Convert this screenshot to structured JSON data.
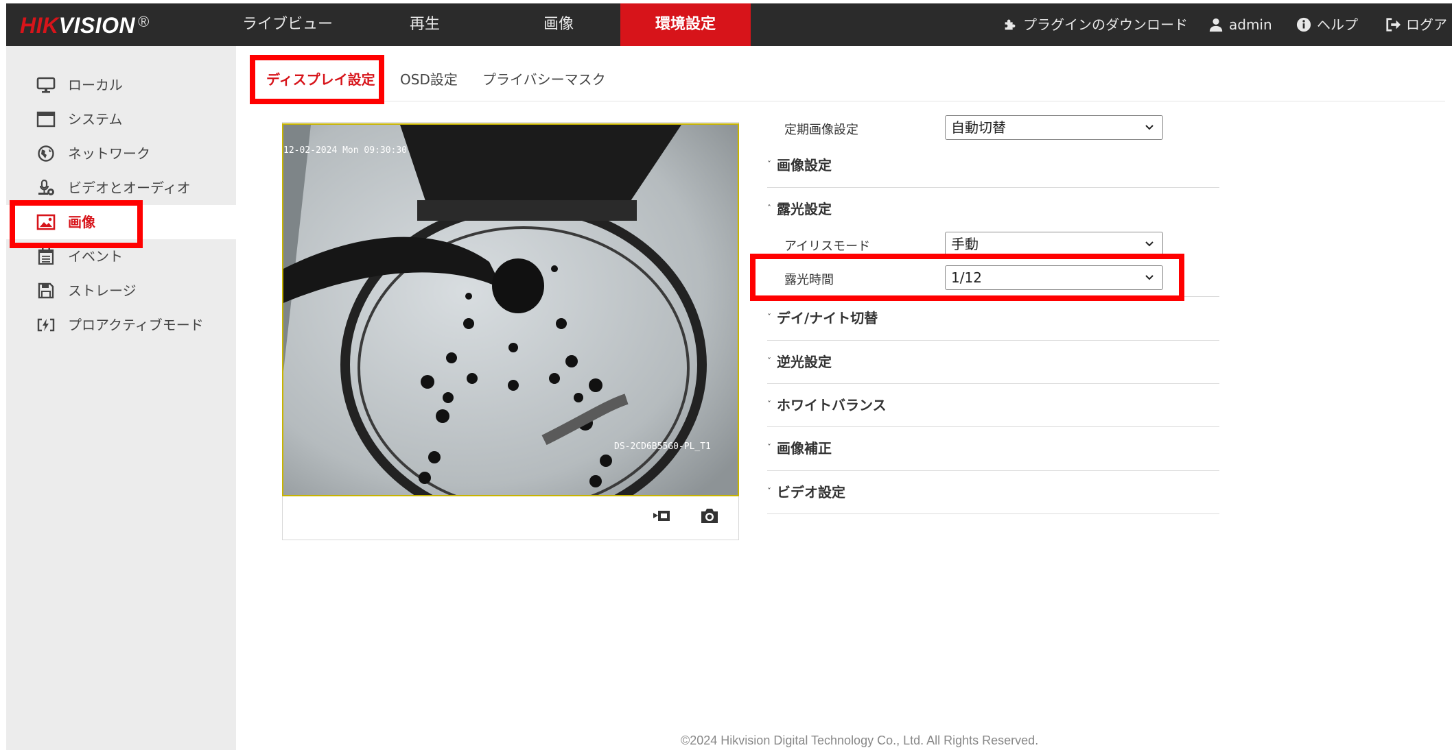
{
  "header": {
    "logo_red": "HIK",
    "logo_white": "VISION",
    "logo_mark": "®",
    "nav": [
      {
        "label": "ライブビュー"
      },
      {
        "label": "再生"
      },
      {
        "label": "画像"
      },
      {
        "label": "環境設定",
        "active": true
      }
    ],
    "plugin_label": "プラグインのダウンロード",
    "user_label": "admin",
    "help_label": "ヘルプ",
    "logout_label": "ログア"
  },
  "sidebar": {
    "items": [
      {
        "label": "ローカル",
        "icon": "monitor-icon"
      },
      {
        "label": "システム",
        "icon": "window-icon"
      },
      {
        "label": "ネットワーク",
        "icon": "globe-icon"
      },
      {
        "label": "ビデオとオーディオ",
        "icon": "mic-camera-icon"
      },
      {
        "label": "画像",
        "icon": "image-icon",
        "active": true
      },
      {
        "label": "イベント",
        "icon": "calendar-icon"
      },
      {
        "label": "ストレージ",
        "icon": "floppy-icon"
      },
      {
        "label": "プロアクティブモード",
        "icon": "proactive-icon"
      }
    ]
  },
  "tabs": [
    {
      "label": "ディスプレイ設定",
      "active": true
    },
    {
      "label": "OSD設定"
    },
    {
      "label": "プライバシーマスク"
    }
  ],
  "video": {
    "timestamp": "12-02-2024 Mon 09:30:30",
    "camera_name": "DS-2CD6B55G0-PL_T1",
    "record_icon": "video-record-icon",
    "snapshot_icon": "camera-icon"
  },
  "settings": {
    "schedule_label": "定期画像設定",
    "schedule_value": "自動切替",
    "sections": {
      "image": "画像設定",
      "exposure": "露光設定",
      "daynight": "デイ/ナイト切替",
      "backlight": "逆光設定",
      "whitebalance": "ホワイトバランス",
      "enhance": "画像補正",
      "video": "ビデオ設定"
    },
    "iris_label": "アイリスモード",
    "iris_value": "手動",
    "exposure_time_label": "露光時間",
    "exposure_time_value": "1/12"
  },
  "colors": {
    "accent": "#d7141a",
    "highlight": "#ff0000",
    "topbar": "#2b2b2b",
    "sidebar": "#ececec"
  },
  "footer": "©2024 Hikvision Digital Technology Co., Ltd. All Rights Reserved."
}
